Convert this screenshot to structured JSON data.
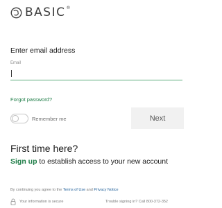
{
  "brand": {
    "name": "BASIC",
    "reg_mark": "®",
    "logo_icon": "basic-logo-icon"
  },
  "form": {
    "heading": "Enter email address",
    "email_label": "Email",
    "email_value": "",
    "forgot_password": "Forgot password?",
    "remember_me": "Remember me",
    "remember_me_on": false,
    "next_button": "Next"
  },
  "signup": {
    "heading": "First time here?",
    "link": "Sign up",
    "text": " to establish access to your new account"
  },
  "footer": {
    "terms_prefix": "By continuing you agree to the ",
    "terms_link": "Terms of Use",
    "terms_and": " and ",
    "privacy_link": "Privacy Notice",
    "secure_text": "Your information is secure",
    "trouble_text": "Trouble signing in? Call 800-372-352"
  },
  "colors": {
    "accent": "#1e7d47",
    "input_underline": "#5aab7a",
    "link_blue": "#1f5f99",
    "button_bg": "#f1f1f1"
  }
}
